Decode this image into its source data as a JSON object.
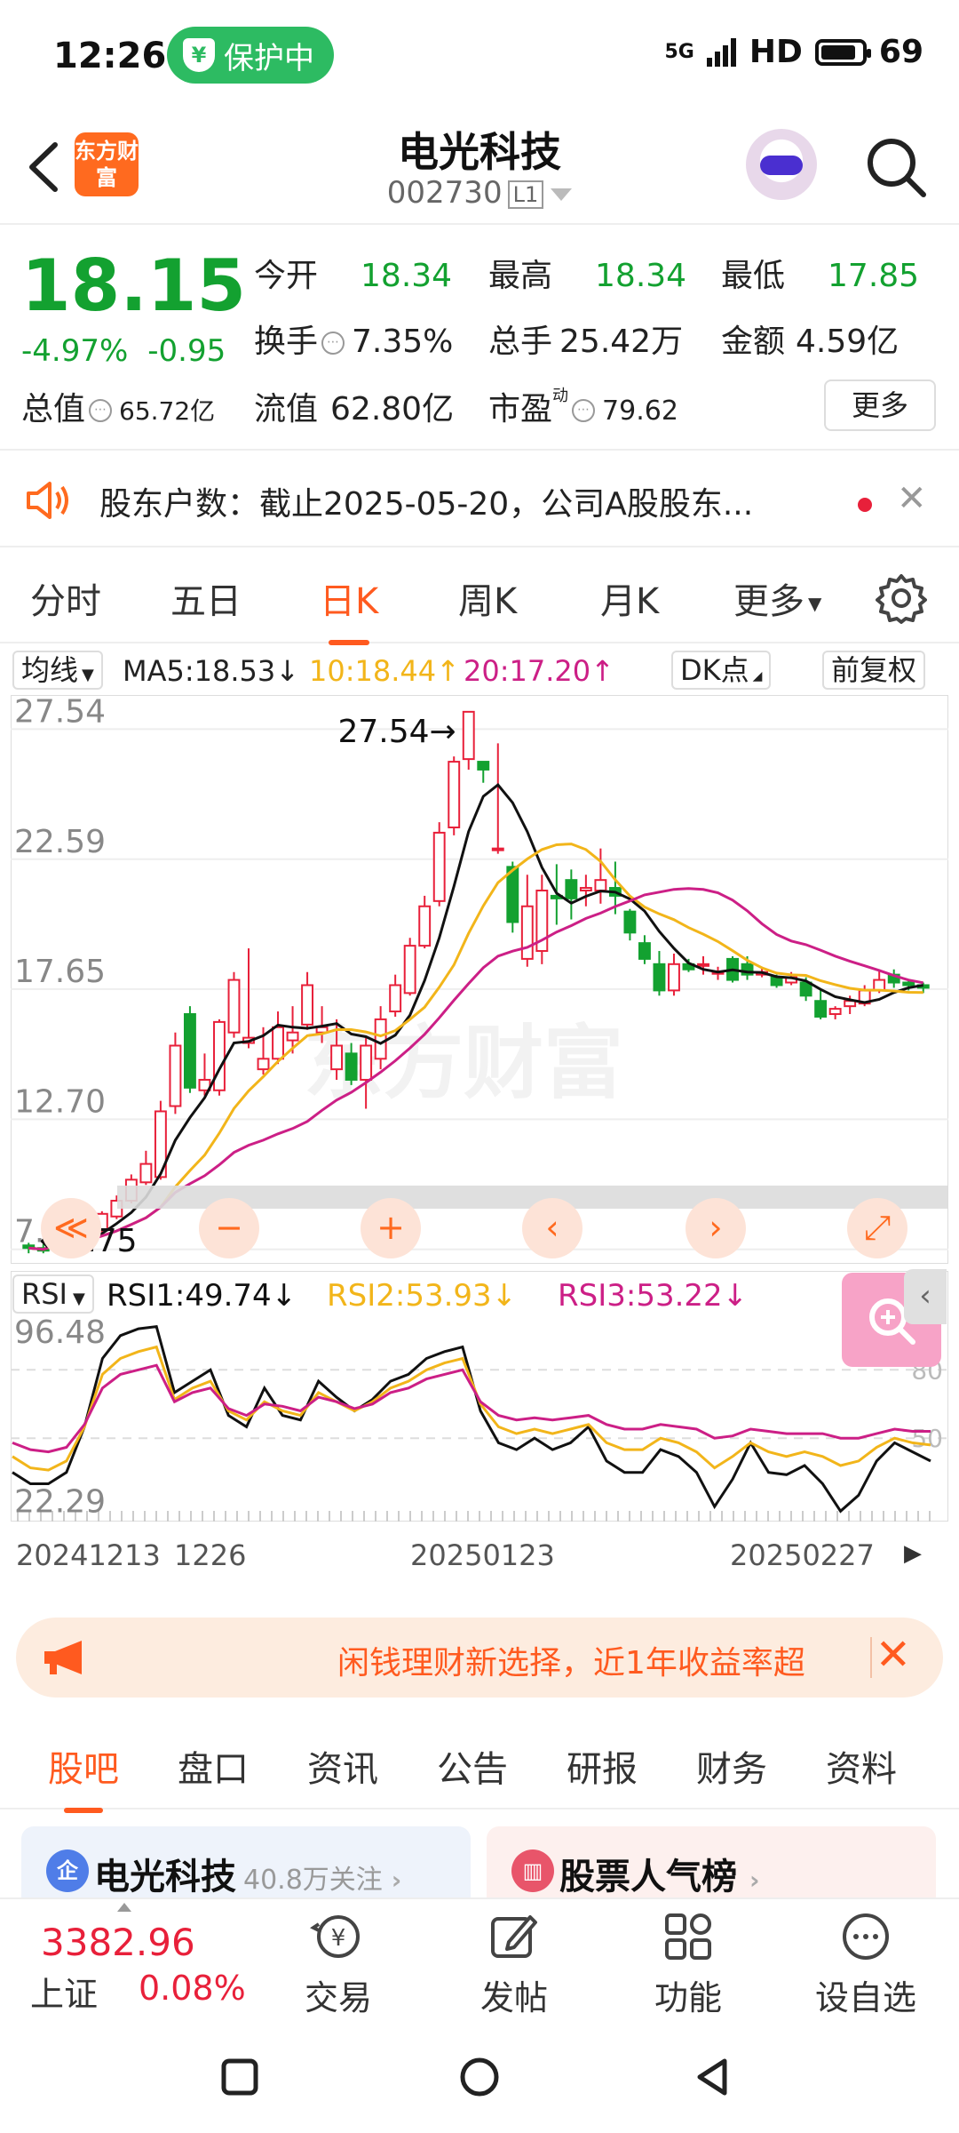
{
  "status_bar": {
    "time": "12:26",
    "protect_label": "保护中",
    "network": "5G",
    "hd": "HD",
    "battery": "69"
  },
  "header": {
    "logo_text": "东方财富",
    "title": "电光科技",
    "code": "002730",
    "level": "L1"
  },
  "quote": {
    "price": "18.15",
    "change_pct": "-4.97%",
    "change": "-0.95",
    "open_label": "今开",
    "open": "18.34",
    "high_label": "最高",
    "high": "18.34",
    "low_label": "最低",
    "low": "17.85",
    "turnover_label": "换手",
    "turnover": "7.35%",
    "volume_label": "总手",
    "volume": "25.42万",
    "amount_label": "金额",
    "amount": "4.59亿",
    "mktcap_label": "总值",
    "mktcap": "65.72亿",
    "float_label": "流值",
    "float": "62.80亿",
    "pe_label": "市盈",
    "pe_sup": "动",
    "pe": "79.62",
    "more": "更多"
  },
  "notice": {
    "text": "股东户数：截止2025-05-20，公司A股股东..."
  },
  "period_tabs": [
    "分时",
    "五日",
    "日K",
    "周K",
    "月K",
    "更多"
  ],
  "ma_legend": {
    "selector": "均线",
    "ma5": "MA5:18.53↓",
    "ma10": "10:18.44↑",
    "ma20": "20:17.20↑",
    "dk": "DK点",
    "adjust": "前复权"
  },
  "rsi_legend": {
    "selector": "RSI",
    "rsi1": "RSI1:49.74↓",
    "rsi2": "RSI2:53.93↓",
    "rsi3": "RSI3:53.22↓"
  },
  "dates": [
    "20241213",
    "1226",
    "20250123",
    "20250227"
  ],
  "colors": {
    "up": "#e8203a",
    "down": "#13a130",
    "ma5": "#111111",
    "ma10": "#f2b51a",
    "ma20": "#cc1f86",
    "accent": "#ff5a1f"
  },
  "chart_data": [
    {
      "type": "candlestick",
      "title": "日K",
      "y_ticks": [
        "27.54",
        "22.59",
        "17.65",
        "12.70",
        "7.75"
      ],
      "ylim": [
        7.2,
        28.5
      ],
      "max_label": "27.54",
      "min_label": "7.75",
      "candles": [
        [
          7.9,
          7.8,
          8.0,
          7.6
        ],
        [
          7.8,
          7.7,
          7.95,
          7.6
        ],
        [
          7.8,
          8.3,
          8.4,
          7.7
        ],
        [
          8.2,
          8.05,
          8.4,
          7.9
        ],
        [
          8.0,
          8.6,
          8.8,
          7.8
        ],
        [
          8.5,
          9.1,
          9.2,
          8.4
        ],
        [
          9.0,
          9.6,
          9.8,
          8.9
        ],
        [
          9.6,
          10.4,
          10.6,
          9.5
        ],
        [
          10.3,
          11.0,
          11.5,
          10.2
        ],
        [
          10.5,
          13.0,
          13.4,
          10.4
        ],
        [
          13.2,
          15.5,
          16.0,
          12.9
        ],
        [
          16.7,
          13.9,
          17.0,
          13.7
        ],
        [
          13.8,
          14.2,
          15.2,
          13.6
        ],
        [
          13.8,
          16.4,
          16.5,
          13.6
        ],
        [
          16.0,
          18.0,
          18.3,
          15.8
        ],
        [
          15.6,
          15.8,
          19.2,
          15.4
        ],
        [
          14.6,
          15.0,
          16.2,
          14.4
        ],
        [
          15.0,
          16.2,
          16.8,
          14.8
        ],
        [
          15.7,
          16.0,
          17.0,
          15.2
        ],
        [
          16.3,
          17.8,
          18.3,
          16.1
        ],
        [
          16.0,
          16.2,
          17.0,
          15.6
        ],
        [
          14.6,
          15.5,
          16.5,
          14.2
        ],
        [
          15.2,
          14.2,
          15.6,
          14.0
        ],
        [
          14.2,
          15.5,
          15.8,
          13.1
        ],
        [
          15.0,
          16.5,
          17.0,
          14.6
        ],
        [
          16.8,
          17.8,
          18.2,
          16.6
        ],
        [
          17.5,
          19.3,
          19.6,
          17.4
        ],
        [
          19.3,
          20.8,
          21.2,
          19.2
        ],
        [
          21.0,
          23.6,
          24.0,
          20.8
        ],
        [
          23.8,
          26.3,
          26.5,
          23.5
        ],
        [
          26.4,
          28.2,
          28.2,
          26.0
        ],
        [
          26.3,
          26.0,
          26.3,
          25.5
        ],
        [
          23.0,
          23.0,
          27.0,
          22.8
        ],
        [
          22.3,
          20.2,
          22.5,
          19.8
        ],
        [
          18.8,
          20.8,
          22.0,
          18.5
        ],
        [
          19.1,
          21.4,
          22.0,
          18.6
        ],
        [
          21.2,
          21.1,
          22.4,
          20.1
        ],
        [
          21.8,
          21.1,
          22.2,
          20.3
        ],
        [
          21.4,
          21.5,
          22.0,
          20.8
        ],
        [
          21.4,
          21.8,
          23.0,
          20.9
        ],
        [
          21.5,
          21.2,
          22.5,
          20.5
        ],
        [
          20.6,
          19.8,
          20.7,
          19.5
        ],
        [
          19.4,
          18.8,
          19.7,
          18.6
        ],
        [
          18.6,
          17.6,
          19.1,
          17.4
        ],
        [
          17.6,
          18.6,
          19.0,
          17.4
        ],
        [
          18.6,
          18.4,
          18.8,
          18.3
        ],
        [
          18.6,
          18.6,
          18.9,
          18.2
        ],
        [
          18.3,
          18.3,
          18.5,
          18.0
        ],
        [
          18.8,
          18.0,
          18.9,
          17.9
        ],
        [
          18.6,
          18.2,
          18.9,
          18.0
        ],
        [
          18.2,
          18.3,
          18.5,
          18.1
        ],
        [
          18.1,
          17.8,
          18.2,
          17.7
        ],
        [
          17.9,
          18.1,
          18.3,
          17.8
        ],
        [
          17.9,
          17.4,
          18.1,
          17.2
        ],
        [
          17.2,
          16.6,
          17.6,
          16.5
        ],
        [
          16.7,
          16.9,
          17.0,
          16.5
        ],
        [
          17.0,
          17.2,
          17.4,
          16.7
        ],
        [
          17.1,
          17.6,
          17.8,
          17.0
        ],
        [
          17.6,
          18.0,
          18.4,
          17.5
        ],
        [
          18.2,
          17.9,
          18.4,
          17.7
        ],
        [
          17.9,
          17.8,
          18.0,
          17.6
        ],
        [
          17.8,
          17.7,
          17.9,
          17.5
        ]
      ],
      "ma_names": [
        "MA5",
        "MA10",
        "MA20"
      ]
    },
    {
      "type": "line",
      "title": "RSI",
      "y_ticks": [
        "96.48",
        "22.29"
      ],
      "ref_lines": [
        "80",
        "50"
      ],
      "ylim": [
        15,
        100
      ],
      "series": [
        {
          "name": "RSI1",
          "values": [
            35,
            30,
            30,
            35,
            55,
            85,
            95,
            98,
            99,
            70,
            75,
            80,
            60,
            55,
            72,
            60,
            58,
            75,
            68,
            62,
            67,
            75,
            78,
            85,
            88,
            90,
            62,
            48,
            45,
            50,
            45,
            48,
            55,
            40,
            35,
            35,
            45,
            42,
            35,
            20,
            32,
            48,
            35,
            34,
            38,
            30,
            18,
            25,
            40,
            48,
            44,
            40
          ]
        },
        {
          "name": "RSI2",
          "values": [
            42,
            37,
            36,
            40,
            55,
            78,
            85,
            88,
            90,
            67,
            72,
            75,
            62,
            58,
            66,
            62,
            60,
            70,
            66,
            62,
            66,
            72,
            75,
            80,
            83,
            85,
            65,
            55,
            52,
            54,
            52,
            54,
            56,
            48,
            45,
            45,
            50,
            48,
            44,
            37,
            42,
            48,
            44,
            42,
            44,
            42,
            38,
            40,
            46,
            50,
            48,
            47
          ]
        },
        {
          "name": "RSI3",
          "values": [
            48,
            45,
            44,
            46,
            56,
            72,
            78,
            80,
            82,
            66,
            70,
            72,
            63,
            60,
            65,
            64,
            62,
            68,
            66,
            63,
            65,
            70,
            72,
            76,
            78,
            80,
            66,
            60,
            58,
            59,
            58,
            59,
            60,
            56,
            54,
            54,
            56,
            55,
            54,
            50,
            51,
            54,
            53,
            52,
            52,
            52,
            50,
            50,
            52,
            54,
            53,
            53
          ]
        }
      ]
    }
  ],
  "zoom_buttons": [
    "≪",
    "−",
    "+",
    "‹",
    "›",
    "⤢"
  ],
  "promo": {
    "text": "闲钱理财新选择，近1年收益率超"
  },
  "bottom_tabs": [
    "股吧",
    "盘口",
    "资讯",
    "公告",
    "研报",
    "财务",
    "资料"
  ],
  "cards": {
    "card1_icon": "企",
    "card1_name": "电光科技",
    "card1_follow": "40.8万关注",
    "card2_name": "股票人气榜"
  },
  "bottom_nav": {
    "index_value": "3382.96",
    "index_name": "上证",
    "index_pct": "0.08%",
    "items": [
      "交易",
      "发帖",
      "功能",
      "设自选"
    ]
  }
}
